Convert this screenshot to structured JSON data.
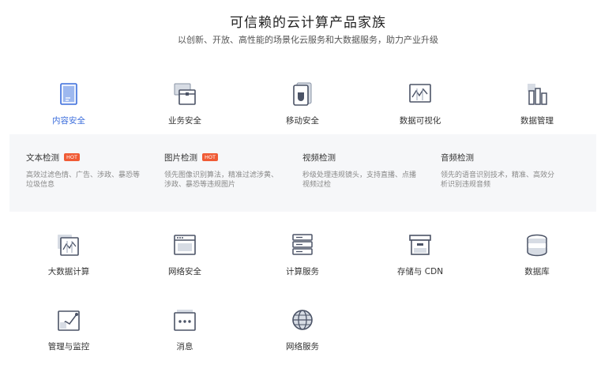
{
  "header": {
    "title": "可信赖的云计算产品家族",
    "subtitle": "以创新、开放、高性能的场景化云服务和大数据服务，助力产业升级"
  },
  "top_categories": [
    {
      "label": "内容安全",
      "icon": "content-security-icon",
      "active": true
    },
    {
      "label": "业务安全",
      "icon": "business-security-icon"
    },
    {
      "label": "移动安全",
      "icon": "mobile-security-icon"
    },
    {
      "label": "数据可视化",
      "icon": "data-visualization-icon"
    },
    {
      "label": "数据管理",
      "icon": "data-management-icon"
    }
  ],
  "detail_panel": {
    "items": [
      {
        "name": "文本检测",
        "badge": "HOT",
        "desc": "高效过滤色情、广告、涉政、暴恐等垃圾信息"
      },
      {
        "name": "图片检测",
        "badge": "HOT",
        "desc": "领先图像识别算法，精准过滤涉黄、涉政、暴恐等违规图片"
      },
      {
        "name": "视频检测",
        "desc": "秒级处理违规镜头，支持直播、点播视频过检"
      },
      {
        "name": "音频检测",
        "desc": "领先的语音识别技术，精准、高效分析识别违规音频"
      }
    ]
  },
  "row2": [
    {
      "label": "大数据计算",
      "icon": "big-data-computing-icon"
    },
    {
      "label": "网络安全",
      "icon": "network-security-icon"
    },
    {
      "label": "计算服务",
      "icon": "computing-service-icon"
    },
    {
      "label": "存储与 CDN",
      "icon": "storage-cdn-icon"
    },
    {
      "label": "数据库",
      "icon": "database-icon"
    }
  ],
  "row3": [
    {
      "label": "管理与监控",
      "icon": "management-monitoring-icon"
    },
    {
      "label": "消息",
      "icon": "message-icon"
    },
    {
      "label": "网络服务",
      "icon": "network-service-icon"
    }
  ],
  "colors": {
    "accent": "#3c6edc",
    "hot_badge": "#f05b35",
    "panel_bg": "#f6f7f9"
  }
}
